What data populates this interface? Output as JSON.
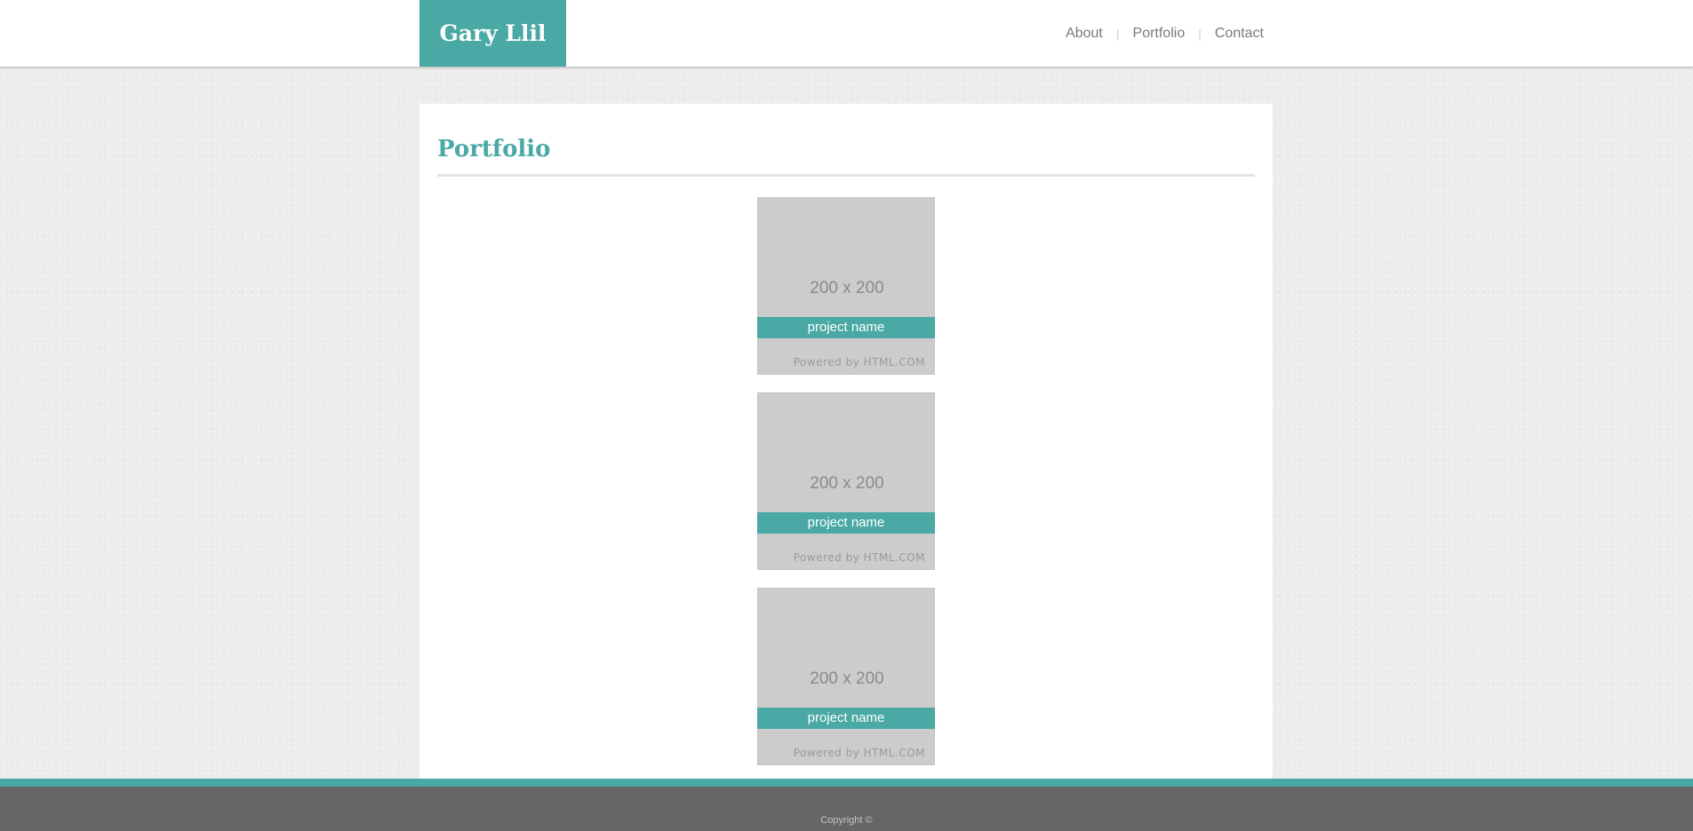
{
  "header": {
    "logo": "Gary Llil",
    "nav": [
      {
        "label": "About"
      },
      {
        "label": "Portfolio"
      },
      {
        "label": "Contact"
      }
    ]
  },
  "main": {
    "title": "Portfolio",
    "projects": [
      {
        "dims": "200 x 200",
        "name": "project name",
        "powered": "Powered by HTML.COM"
      },
      {
        "dims": "200 x 200",
        "name": "project name",
        "powered": "Powered by HTML.COM"
      },
      {
        "dims": "200 x 200",
        "name": "project name",
        "powered": "Powered by HTML.COM"
      }
    ]
  },
  "footer": {
    "copyright": "Copyright ©"
  },
  "colors": {
    "accent": "#4aa9a4",
    "footer": "#666666",
    "placeholder": "#cccccc"
  }
}
